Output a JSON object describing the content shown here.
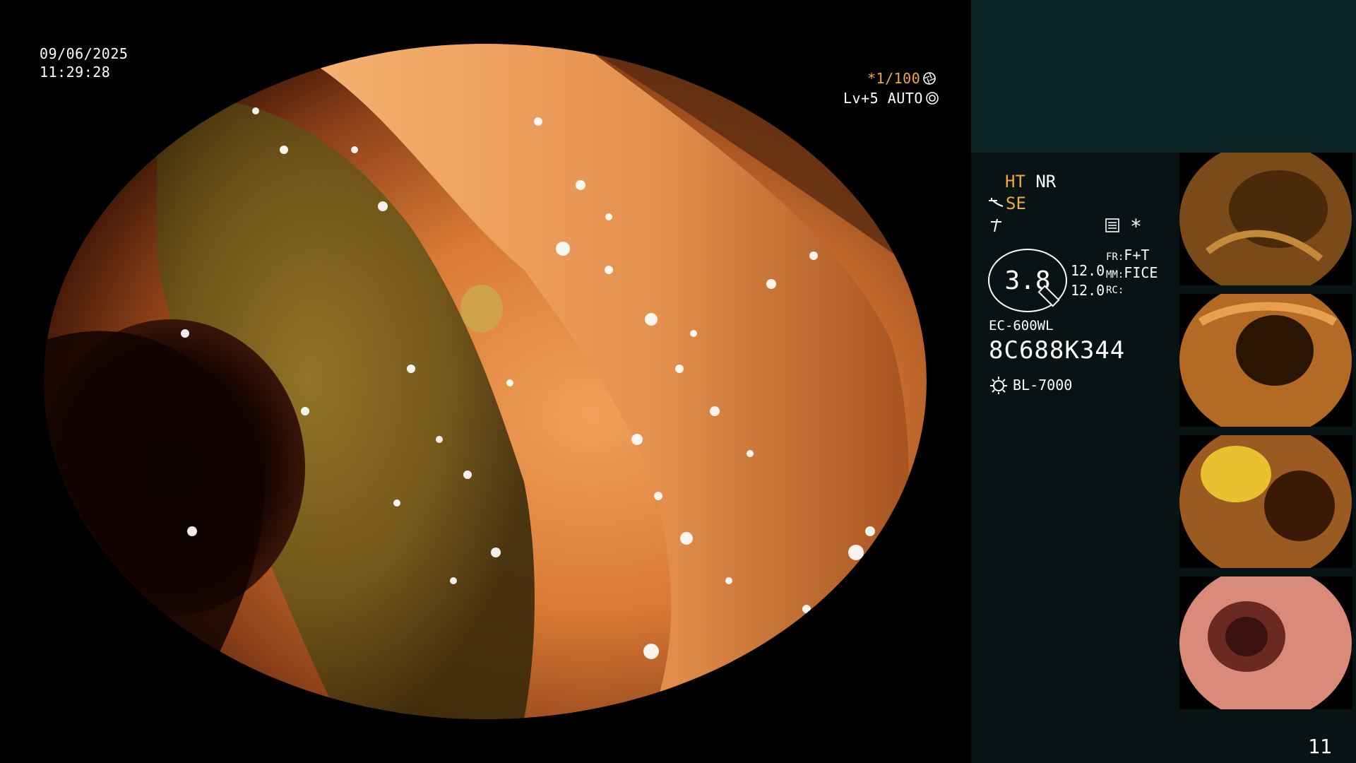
{
  "overlay": {
    "date": "09/06/2025",
    "time": "11:29:28",
    "shutter": "*1/100",
    "shutter_icon": "aperture-icon",
    "level": "Lv+5 AUTO",
    "level_icon": "iris-icon"
  },
  "panel": {
    "ht": "HT",
    "nr": "NR",
    "se": "SE",
    "se_icon": "scope-tip-icon",
    "mode_icon": "freeze-icon",
    "memo_icon": "memo-icon",
    "star": "*",
    "scope_diameter": "3.8",
    "v1": "12.0",
    "v2": "12.0",
    "fr_label": "FR:",
    "fr_value": "F+T",
    "mm_label": "MM:",
    "mm_value": "FICE",
    "rc_label": "RC:",
    "rc_value": "",
    "scope_model": "EC-600WL",
    "serial": "8C688K344",
    "light_source": "BL-7000",
    "light_icon": "lamp-icon",
    "image_count": "11"
  },
  "colors": {
    "panel_top": "#0d2424",
    "panel_bottom": "#081313",
    "accent": "#f2a838"
  }
}
